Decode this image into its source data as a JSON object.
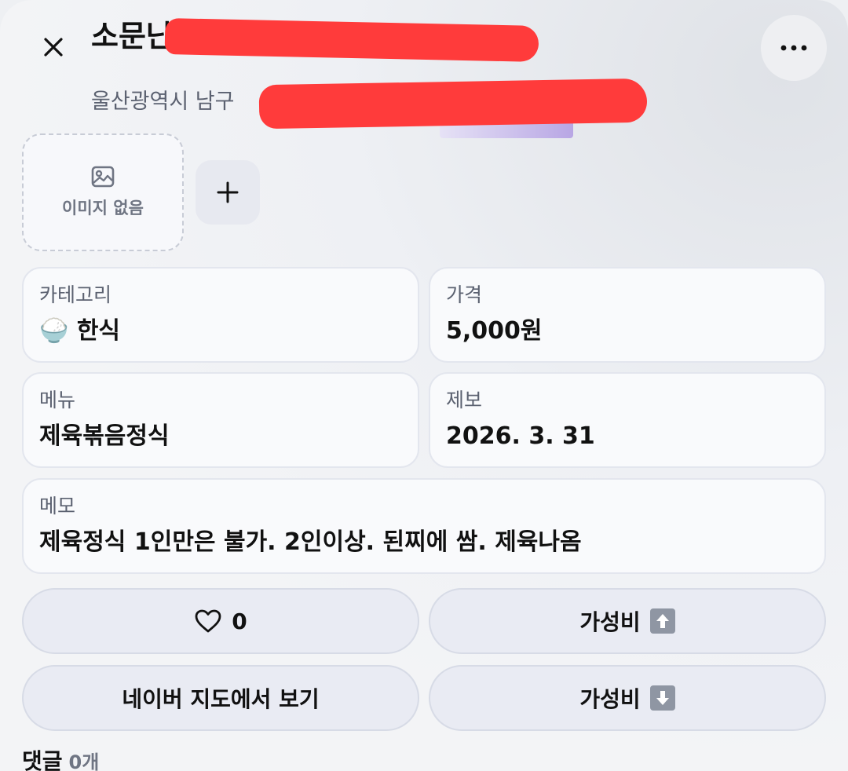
{
  "header": {
    "title": "소문난",
    "address": "울산광역시 남구"
  },
  "images": {
    "empty_label": "이미지 없음"
  },
  "details": {
    "category": {
      "label": "카테고리",
      "emoji": "🍚",
      "value": "한식"
    },
    "price": {
      "label": "가격",
      "value": "5,000원"
    },
    "menu": {
      "label": "메뉴",
      "value": "제육볶음정식"
    },
    "reported": {
      "label": "제보",
      "value": "2026. 3. 31"
    },
    "memo": {
      "label": "메모",
      "value": "제육정식 1인만은 불가. 2인이상. 된찌에 쌈. 제육나옴"
    }
  },
  "actions": {
    "like_count": "0",
    "value_up_label": "가성비",
    "value_down_label": "가성비",
    "naver_map_label": "네이버 지도에서 보기"
  },
  "comments": {
    "title": "댓글",
    "count": "0개"
  },
  "icons": {
    "close": "close-icon",
    "more": "more-icon",
    "image": "image-icon",
    "add": "plus-icon",
    "heart": "heart-icon",
    "arrow_up": "arrow-up-icon",
    "arrow_down": "arrow-down-icon"
  },
  "colors": {
    "redaction": "#ff3b3b",
    "card_bg": "#f9fafc",
    "button_bg": "#e9ebf3"
  }
}
